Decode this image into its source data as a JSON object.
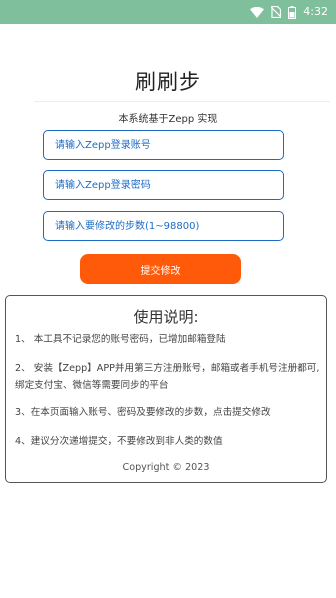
{
  "status_bar": {
    "time": "4:32",
    "icons": [
      "wifi-icon",
      "no-sim-icon",
      "battery-icon"
    ],
    "background": "#7fbf9c"
  },
  "page": {
    "title": "刷刷步",
    "subtitle": "本系统基于Zepp 实现"
  },
  "form": {
    "account_placeholder": "请输入Zepp登录账号",
    "password_placeholder": "请输入Zepp登录密码",
    "steps_placeholder": "请输入要修改的步数(1~98800)",
    "submit_label": "提交修改",
    "accent_color": "#1e6bc4",
    "button_color": "#ff5a0a"
  },
  "usage": {
    "title": "使用说明:",
    "items": [
      "1、 本工具不记录您的账号密码，已增加邮箱登陆",
      "2、 安装【Zepp】APP并用第三方注册账号，邮箱或者手机号注册都可,绑定支付宝、微信等需要同步的平台",
      "3、在本页面输入账号、密码及要修改的步数，点击提交修改",
      "4、建议分次递增提交，不要修改到非人类的数值"
    ],
    "copyright": "Copyright © 2023"
  }
}
